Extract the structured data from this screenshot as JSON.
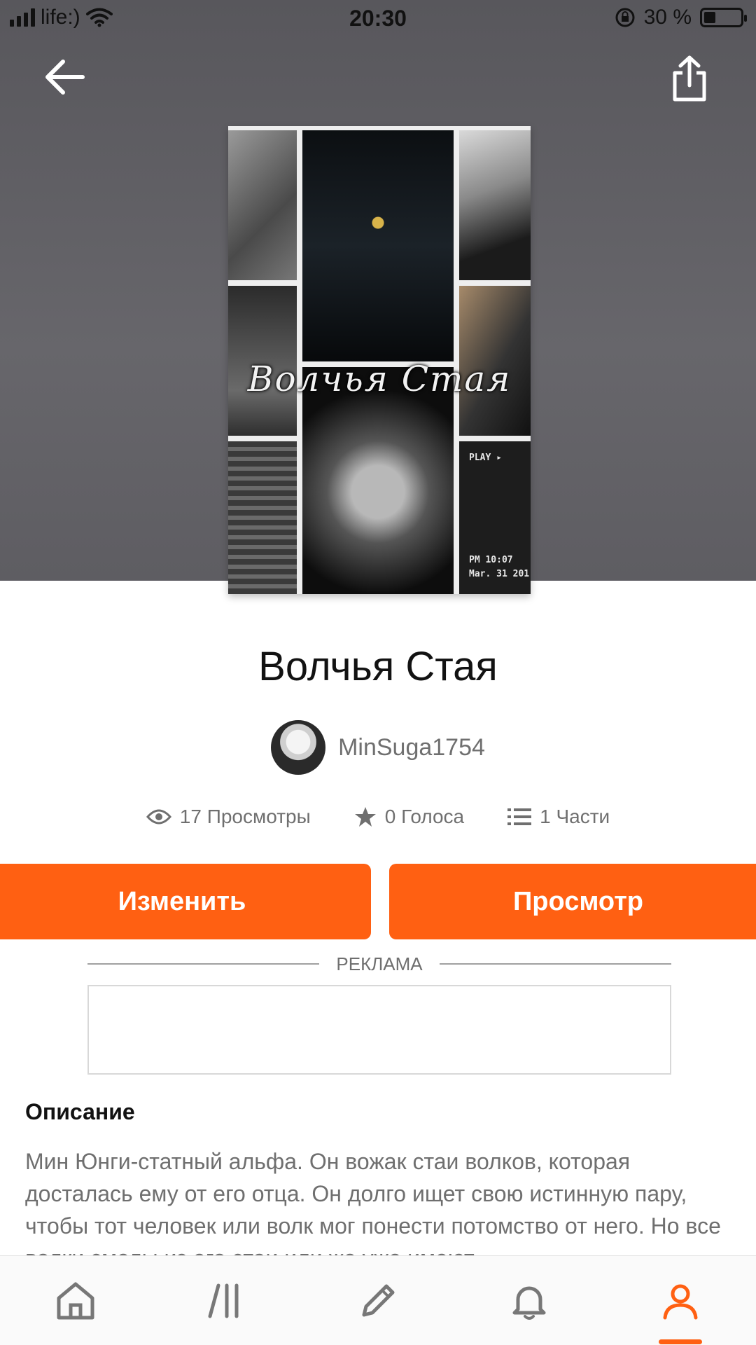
{
  "status_bar": {
    "carrier": "life:)",
    "time": "20:30",
    "battery": "30 %"
  },
  "book": {
    "title": "Волчья Стая",
    "cover_title": "Волчья Стая",
    "cover_play": "PLAY ▸",
    "cover_time": "PM 10:07",
    "cover_date": "Mar. 31 201",
    "author": "MinSuga1754"
  },
  "stats": {
    "views": "17 Просмотры",
    "votes": "0 Голоса",
    "parts": "1 Части"
  },
  "actions": {
    "edit_label": "Изменить",
    "view_label": "Просмотр"
  },
  "ad": {
    "label": "РЕКЛАМА"
  },
  "description": {
    "title": "Описание",
    "text": "Мин Юнги-статный альфа. Он вожак стаи волков, которая досталась ему от его отца. Он долго ищет свою истинную пару, чтобы тот человек или волк мог понести потомство от него. Но все волки смелы из его стаи или же уже имеют"
  },
  "colors": {
    "accent": "#ff6012",
    "header_bg": "#616065",
    "text_secondary": "#6f6f6f"
  },
  "tabs": [
    {
      "name": "home-icon"
    },
    {
      "name": "library-icon"
    },
    {
      "name": "write-icon"
    },
    {
      "name": "bell-icon"
    },
    {
      "name": "profile-icon",
      "active": true
    }
  ]
}
